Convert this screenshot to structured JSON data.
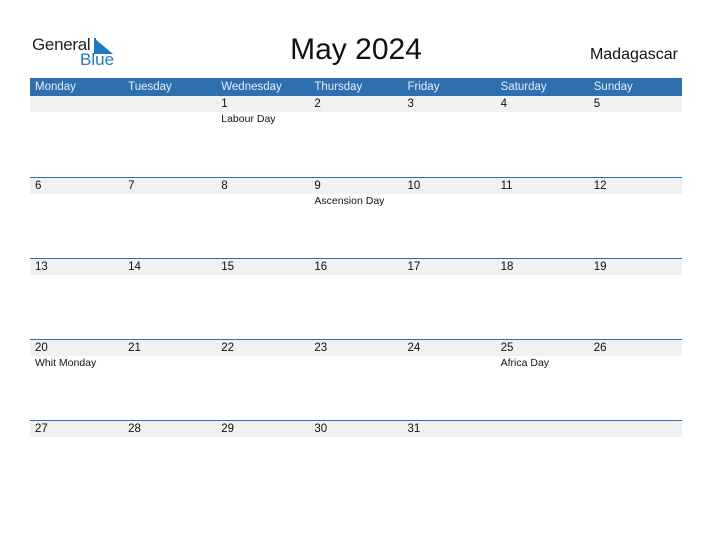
{
  "brand": {
    "general": "General",
    "blue": "Blue"
  },
  "title": "May 2024",
  "country": "Madagascar",
  "weekdays": [
    "Monday",
    "Tuesday",
    "Wednesday",
    "Thursday",
    "Friday",
    "Saturday",
    "Sunday"
  ],
  "weeks": [
    [
      {
        "d": "",
        "h": ""
      },
      {
        "d": "",
        "h": ""
      },
      {
        "d": "1",
        "h": "Labour Day"
      },
      {
        "d": "2",
        "h": ""
      },
      {
        "d": "3",
        "h": ""
      },
      {
        "d": "4",
        "h": ""
      },
      {
        "d": "5",
        "h": ""
      }
    ],
    [
      {
        "d": "6",
        "h": ""
      },
      {
        "d": "7",
        "h": ""
      },
      {
        "d": "8",
        "h": ""
      },
      {
        "d": "9",
        "h": "Ascension Day"
      },
      {
        "d": "10",
        "h": ""
      },
      {
        "d": "11",
        "h": ""
      },
      {
        "d": "12",
        "h": ""
      }
    ],
    [
      {
        "d": "13",
        "h": ""
      },
      {
        "d": "14",
        "h": ""
      },
      {
        "d": "15",
        "h": ""
      },
      {
        "d": "16",
        "h": ""
      },
      {
        "d": "17",
        "h": ""
      },
      {
        "d": "18",
        "h": ""
      },
      {
        "d": "19",
        "h": ""
      }
    ],
    [
      {
        "d": "20",
        "h": "Whit Monday"
      },
      {
        "d": "21",
        "h": ""
      },
      {
        "d": "22",
        "h": ""
      },
      {
        "d": "23",
        "h": ""
      },
      {
        "d": "24",
        "h": ""
      },
      {
        "d": "25",
        "h": "Africa Day"
      },
      {
        "d": "26",
        "h": ""
      }
    ],
    [
      {
        "d": "27",
        "h": ""
      },
      {
        "d": "28",
        "h": ""
      },
      {
        "d": "29",
        "h": ""
      },
      {
        "d": "30",
        "h": ""
      },
      {
        "d": "31",
        "h": ""
      },
      {
        "d": "",
        "h": ""
      },
      {
        "d": "",
        "h": ""
      }
    ]
  ]
}
